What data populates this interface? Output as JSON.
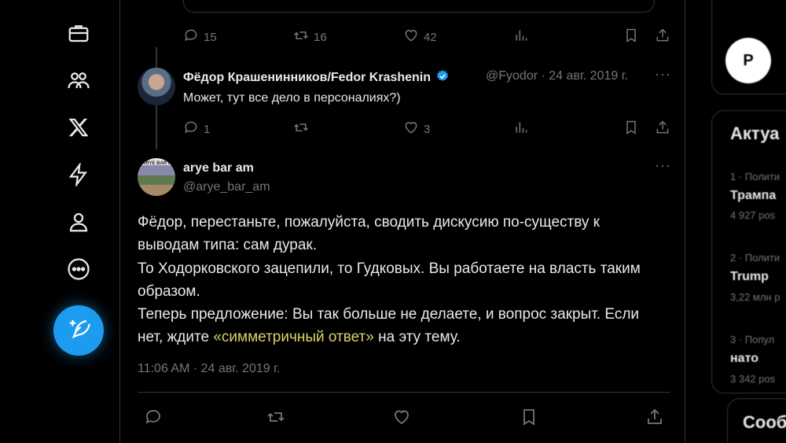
{
  "nav": {
    "items": [
      "briefcase-icon",
      "communities-icon",
      "x-logo-icon",
      "lightning-icon",
      "profile-icon",
      "more-icon"
    ],
    "compose_icon": "feather-plus-icon"
  },
  "top_tweet_actions": {
    "replies": "15",
    "retweets": "16",
    "likes": "42"
  },
  "reply": {
    "display_name": "Фёдор Крашенинников/Fedor Krashenin",
    "meta": "@Fyodor · 24 авг. 2019 г.",
    "text": "Может, тут все дело в персоналиях?)",
    "replies": "1",
    "retweets": "",
    "likes": "3"
  },
  "tweet": {
    "display_name": "arye bar am",
    "handle": "@arye_bar_am",
    "avatar_text": "ARYE BAR AM",
    "line1": "Фёдор, перестаньте, пожалуйста, сводить дискусию по-существу к",
    "line2": "выводам типа: сам дурак.",
    "line3": "То Ходорковского зацепили, то Гудковых. Вы работаете на власть таким",
    "line4": "образом.",
    "line5": "Теперь предложение: Вы так больше не делаете, и вопрос закрыт. Если",
    "line6_pre": "нет, ждите ",
    "line6_link": "«симметричный ответ»",
    "line6_post": " на эту тему.",
    "timestamp": "11:06 AM · 24 авг. 2019 г."
  },
  "right": {
    "logo_text": "Р",
    "trends_title": "Актуа",
    "trends": [
      {
        "category": "1 · Полити",
        "name": "Трампа",
        "count": "4 927 pos"
      },
      {
        "category": "2 · Полити",
        "name": "Trump",
        "count": "3,22 млн р"
      },
      {
        "category": "3 · Попул",
        "name": "нато",
        "count": "3 342 pos"
      }
    ],
    "section2_title": "Сооб"
  },
  "colors": {
    "accent": "#1d9bf0",
    "link": "#d9d26a",
    "muted": "#71767b",
    "text": "#e7e9ea"
  }
}
